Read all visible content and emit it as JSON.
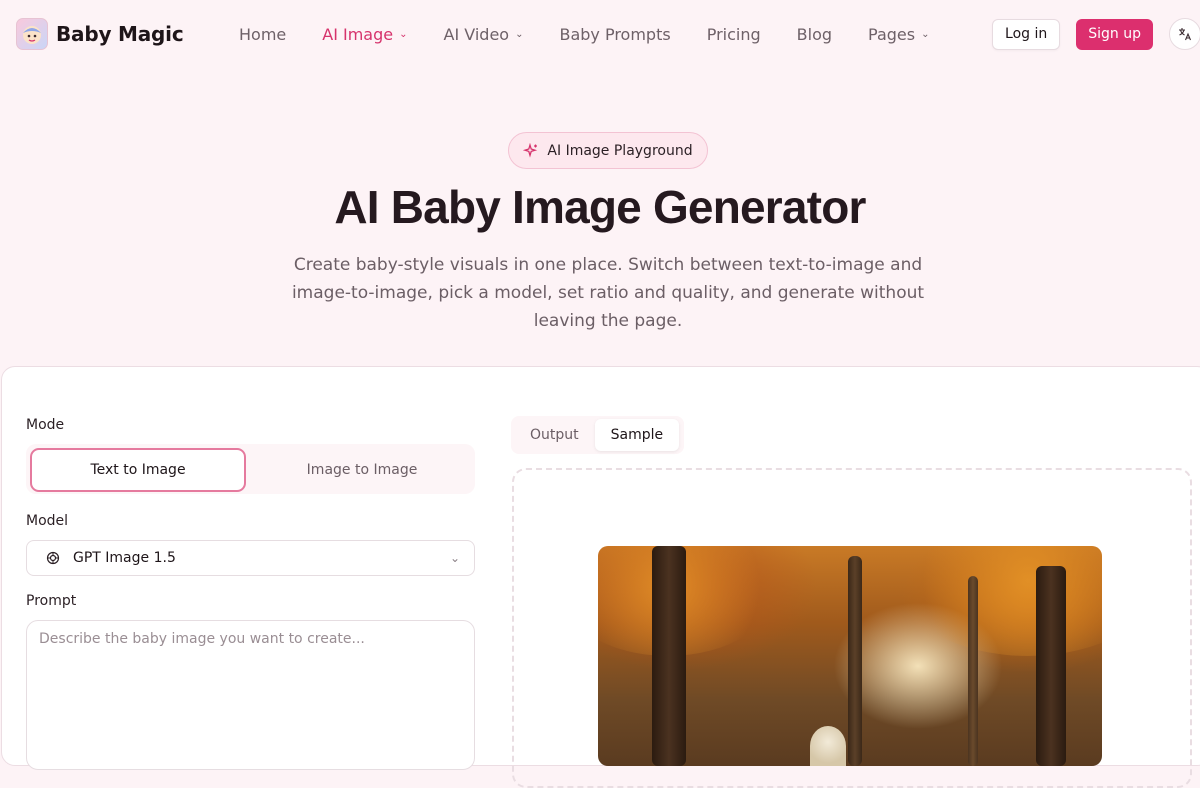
{
  "header": {
    "brand": "Baby Magic",
    "nav": [
      {
        "label": "Home",
        "active": false,
        "dropdown": false
      },
      {
        "label": "AI Image",
        "active": true,
        "dropdown": true
      },
      {
        "label": "AI Video",
        "active": false,
        "dropdown": true
      },
      {
        "label": "Baby Prompts",
        "active": false,
        "dropdown": false
      },
      {
        "label": "Pricing",
        "active": false,
        "dropdown": false
      },
      {
        "label": "Blog",
        "active": false,
        "dropdown": false
      },
      {
        "label": "Pages",
        "active": false,
        "dropdown": true
      }
    ],
    "login_label": "Log in",
    "signup_label": "Sign up",
    "language_icon": "translate-icon"
  },
  "hero": {
    "badge": "AI Image Playground",
    "title": "AI Baby Image Generator",
    "subtitle": "Create baby-style visuals in one place. Switch between text-to-image and image-to-image, pick a model, set ratio and quality, and generate without leaving the page."
  },
  "form": {
    "mode_label": "Mode",
    "modes": [
      "Text to Image",
      "Image to Image"
    ],
    "active_mode": "Text to Image",
    "model_label": "Model",
    "model_value": "GPT Image 1.5",
    "prompt_label": "Prompt",
    "prompt_placeholder": "Describe the baby image you want to create..."
  },
  "preview": {
    "tabs": [
      "Output",
      "Sample"
    ],
    "active_tab": "Sample"
  },
  "colors": {
    "accent": "#dc2f6e",
    "active_nav": "#d6336c",
    "background": "#fdf3f6"
  }
}
